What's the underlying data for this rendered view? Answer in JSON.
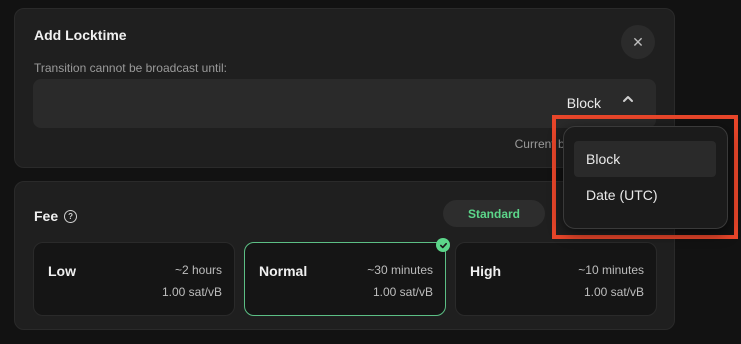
{
  "locktime": {
    "title": "Add Locktime",
    "subtitle": "Transition cannot be broadcast until:",
    "selected_type": "Block",
    "current_block_label": "Current block",
    "close_icon": "close-icon",
    "chevron_icon": "chevron-up-icon"
  },
  "fee": {
    "title": "Fee",
    "help_icon": "?",
    "standard_label": "Standard",
    "options": [
      {
        "name": "Low",
        "time": "~2 hours",
        "rate": "1.00 sat/vB",
        "selected": false
      },
      {
        "name": "Normal",
        "time": "~30 minutes",
        "rate": "1.00 sat/vB",
        "selected": true
      },
      {
        "name": "High",
        "time": "~10 minutes",
        "rate": "1.00 sat/vB",
        "selected": false
      }
    ]
  },
  "dropdown": {
    "items": [
      "Block",
      "Date (UTC)"
    ],
    "active_index": 0,
    "highlight_color": "#e8462a"
  },
  "colors": {
    "accent_green": "#5cd68a",
    "panel_bg": "#1f1f1f",
    "page_bg": "#121212"
  }
}
